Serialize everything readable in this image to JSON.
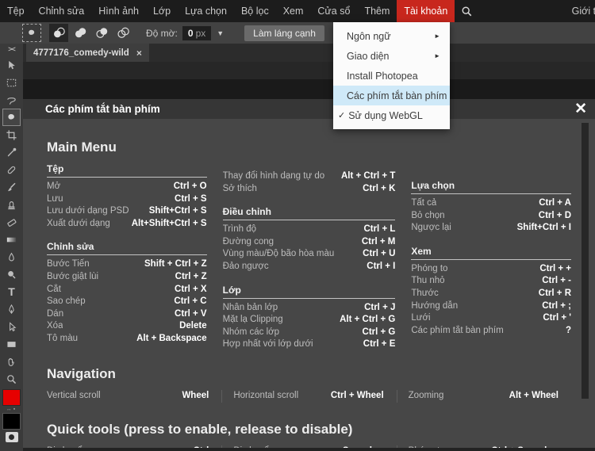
{
  "colors": {
    "accent_red": "#c8271d",
    "menu_highlight_blue": "#cfe9f8",
    "foreground_swatch": "#e60000",
    "background_swatch": "#000000",
    "dialog_bg": "#474747"
  },
  "icons": {
    "submenu_arrow": "►",
    "check": "✓",
    "dropdown_caret": "▼",
    "tab_close": "×",
    "dialog_close": "✕",
    "collapse": "><"
  },
  "menubar": {
    "items": [
      "Tệp",
      "Chỉnh sửa",
      "Hình ảnh",
      "Lớp",
      "Lựa chọn",
      "Bộ lọc",
      "Xem",
      "Cửa sổ",
      "Thêm"
    ],
    "account": "Tài khoản",
    "right_text": "Giới th"
  },
  "optionsbar": {
    "opacity_label": "Độ mờ:",
    "opacity_value": "0",
    "opacity_unit": "px",
    "anti_alias": "Làm láng cạnh"
  },
  "tab": {
    "title": "4777176_comedy-wild"
  },
  "toolbar_tools": [
    "move",
    "marquee",
    "lasso",
    "quick-selection",
    "crop",
    "eyedropper",
    "healing",
    "brush",
    "clone-stamp",
    "eraser",
    "gradient",
    "blur",
    "dodge",
    "type",
    "pen",
    "path-select",
    "shape",
    "hand",
    "zoom"
  ],
  "dropdown": {
    "items": [
      {
        "label": "Ngôn ngữ",
        "submenu": true
      },
      {
        "label": "Giao diện",
        "submenu": true
      },
      {
        "label": "Install Photopea",
        "submenu": false
      },
      {
        "label": "Các phím tắt bàn phím",
        "submenu": false,
        "highlighted": true
      },
      {
        "label": "Sử dụng WebGL",
        "submenu": false,
        "checked": true
      }
    ]
  },
  "dialog": {
    "title": "Các phím tắt bàn phím",
    "heading_main": "Main Menu",
    "tep": {
      "title": "Tệp",
      "rows": [
        {
          "label": "Mở",
          "keys": "Ctrl + O"
        },
        {
          "label": "Lưu",
          "keys": "Ctrl + S"
        },
        {
          "label": "Lưu dưới dạng PSD",
          "keys": "Shift+Ctrl + S"
        },
        {
          "label": "Xuất dưới dạng",
          "keys": "Alt+Shift+Ctrl + S"
        }
      ]
    },
    "chinhsua": {
      "title": "Chỉnh sửa",
      "rows": [
        {
          "label": "Bước Tiến",
          "keys": "Shift + Ctrl + Z"
        },
        {
          "label": "Bước giật lùi",
          "keys": "Ctrl + Z"
        },
        {
          "label": "Cắt",
          "keys": "Ctrl + X"
        },
        {
          "label": "Sao chép",
          "keys": "Ctrl + C"
        },
        {
          "label": "Dán",
          "keys": "Ctrl + V"
        },
        {
          "label": "Xóa",
          "keys": "Delete"
        },
        {
          "label": "Tô màu",
          "keys": "Alt + Backspace"
        }
      ]
    },
    "freeform": {
      "rows": [
        {
          "label": "Thay đổi hình dạng tự do",
          "keys": "Alt + Ctrl + T"
        },
        {
          "label": "Sở thích",
          "keys": "Ctrl + K"
        }
      ]
    },
    "dieuchinh": {
      "title": "Điều chỉnh",
      "rows": [
        {
          "label": "Trình độ",
          "keys": "Ctrl + L"
        },
        {
          "label": "Đường cong",
          "keys": "Ctrl + M"
        },
        {
          "label": "Vùng màu/Độ bão hòa màu",
          "keys": "Ctrl + U"
        },
        {
          "label": "Đảo ngược",
          "keys": "Ctrl + I"
        }
      ]
    },
    "lop": {
      "title": "Lớp",
      "rows": [
        {
          "label": "Nhân bản lớp",
          "keys": "Ctrl + J"
        },
        {
          "label": "Mặt lạ Clipping",
          "keys": "Alt + Ctrl + G"
        },
        {
          "label": "Nhóm các lớp",
          "keys": "Ctrl + G"
        },
        {
          "label": "Hợp nhất với lớp dưới",
          "keys": "Ctrl + E"
        }
      ]
    },
    "luachon": {
      "title": "Lựa chọn",
      "rows": [
        {
          "label": "Tất cả",
          "keys": "Ctrl + A"
        },
        {
          "label": "Bỏ chọn",
          "keys": "Ctrl + D"
        },
        {
          "label": "Ngược lại",
          "keys": "Shift+Ctrl + I"
        }
      ]
    },
    "xem": {
      "title": "Xem",
      "rows": [
        {
          "label": "Phóng to",
          "keys": "Ctrl + +"
        },
        {
          "label": "Thu nhỏ",
          "keys": "Ctrl + -"
        },
        {
          "label": "Thước",
          "keys": "Ctrl + R"
        },
        {
          "label": "Hướng dẫn",
          "keys": "Ctrl + ;"
        },
        {
          "label": "Lưới",
          "keys": "Ctrl + '"
        },
        {
          "label": "Các phím tắt bàn phím",
          "keys": "?"
        }
      ]
    },
    "heading_nav": "Navigation",
    "nav_rows": [
      {
        "label": "Vertical scroll",
        "keys": "Wheel"
      },
      {
        "label": "Horizontal scroll",
        "keys": "Ctrl + Wheel"
      },
      {
        "label": "Zooming",
        "keys": "Alt + Wheel"
      }
    ],
    "heading_quick": "Quick tools (press to enable, release to disable)",
    "quick_rows": [
      {
        "label": "Di chuyển",
        "keys": "Ctrl"
      },
      {
        "label": "Di chuyển",
        "keys": "Spacebar"
      },
      {
        "label": "Phóng to",
        "keys": "Ctrl + Spacebar"
      }
    ]
  }
}
